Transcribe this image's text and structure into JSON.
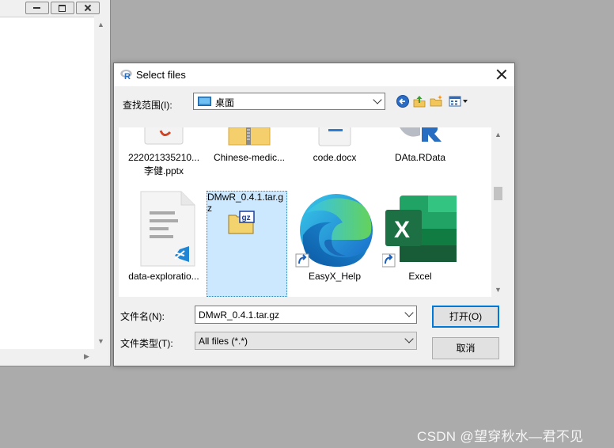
{
  "background_window": {
    "buttons": {
      "minimize": "minimize",
      "maximize": "maximize",
      "close": "close"
    }
  },
  "dialog": {
    "title": "Select files",
    "lookin": {
      "label": "查找范围(I):",
      "value": "桌面"
    },
    "toolbar": [
      "back-icon",
      "up-folder-icon",
      "new-folder-icon",
      "view-menu-icon"
    ],
    "files": {
      "row1": [
        {
          "name_line1": "222021335210...",
          "name_line2": "李健.pptx"
        },
        {
          "name_line1": "Chinese-medic..."
        },
        {
          "name_line1": "code.docx"
        },
        {
          "name_line1": "DAta.RData"
        }
      ],
      "row2": [
        {
          "name_line1": "data-exploratio..."
        },
        {
          "name_line1": "DMwR_0.4.1.tar.g",
          "name_line2": "z",
          "selected": true
        },
        {
          "name_line1": "EasyX_Help"
        },
        {
          "name_line1": "Excel"
        }
      ]
    },
    "filename": {
      "label": "文件名(N):",
      "value": "DMwR_0.4.1.tar.gz"
    },
    "filetype": {
      "label": "文件类型(T):",
      "value": "All files (*.*)"
    },
    "buttons": {
      "open": "打开(O)",
      "cancel": "取消"
    },
    "gz_badge": "gz",
    "excel_letter": "X"
  },
  "watermark": "CSDN @望穿秋水—君不见",
  "colors": {
    "accent": "#0078d7",
    "selection": "#cce8ff",
    "excel_green": "#1d7044"
  }
}
